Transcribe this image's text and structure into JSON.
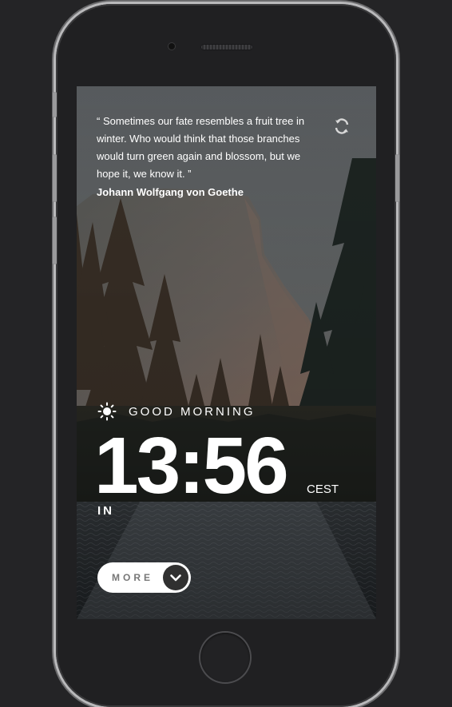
{
  "quote": {
    "text": "“ Sometimes our fate resembles a fruit tree in winter. Who would think that those branches would turn green again and blossom, but we hope it, we know it. ”",
    "author": "Johann Wolfgang von Goethe"
  },
  "greeting": "GOOD MORNING",
  "clock": {
    "time": "13:56",
    "timezone": "CEST"
  },
  "location": "IN",
  "more_button": {
    "label": "MORE"
  },
  "icons": {
    "refresh": "refresh-icon",
    "weather": "sun-icon",
    "chevron": "chevron-down-icon"
  },
  "colors": {
    "device": "#202022",
    "text": "#ffffff",
    "button": "#ffffff",
    "chevron_bg": "#303030"
  }
}
